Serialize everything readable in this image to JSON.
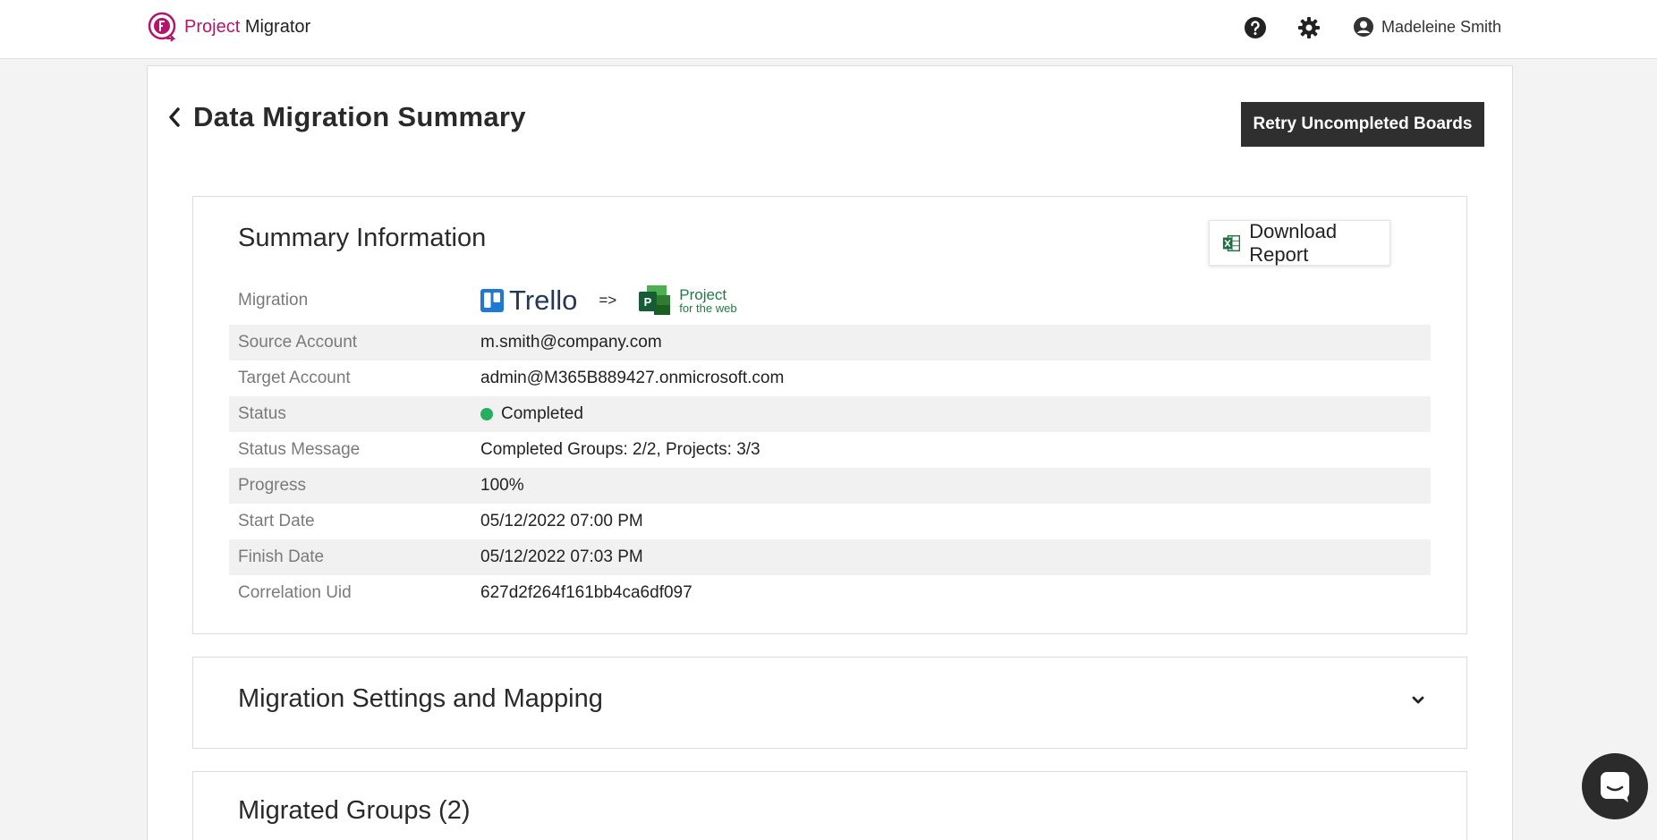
{
  "app": {
    "name_part1": "Project",
    "name_part2": "Migrator",
    "user_name": "Madeleine Smith"
  },
  "icons": {
    "help": "question-circle-icon",
    "settings": "gear-icon",
    "user": "user-circle-icon",
    "back": "chevron-left-icon",
    "excel": "excel-icon",
    "expand": "chevron-down-icon",
    "chat": "chat-icon"
  },
  "page": {
    "title": "Data Migration Summary",
    "retry_label": "Retry Uncompleted Boards"
  },
  "summary": {
    "title": "Summary Information",
    "download_label": "Download Report",
    "migration_label": "Migration",
    "source_name": "Trello",
    "arrow": "=>",
    "target_name_line1": "Project",
    "target_name_line2": "for the web",
    "rows": [
      {
        "label": "Source Account",
        "value": "m.smith@company.com"
      },
      {
        "label": "Target Account",
        "value": "admin@M365B889427.onmicrosoft.com"
      },
      {
        "label": "Status",
        "value": "Completed"
      },
      {
        "label": "Status Message",
        "value": "Completed Groups: 2/2, Projects: 3/3"
      },
      {
        "label": "Progress",
        "value": "100%"
      },
      {
        "label": "Start Date",
        "value": "05/12/2022 07:00 PM"
      },
      {
        "label": "Finish Date",
        "value": "05/12/2022 07:03 PM"
      },
      {
        "label": "Correlation Uid",
        "value": "627d2f264f161bb4ca6df097"
      }
    ]
  },
  "settings_panel": {
    "title": "Migration Settings and Mapping"
  },
  "groups_panel": {
    "title": "Migrated Groups (2)"
  },
  "colors": {
    "brand": "#b5146c",
    "dark_button": "#2f2f2f",
    "status_completed": "#27ae60",
    "row_alt": "#f1f1f1"
  }
}
